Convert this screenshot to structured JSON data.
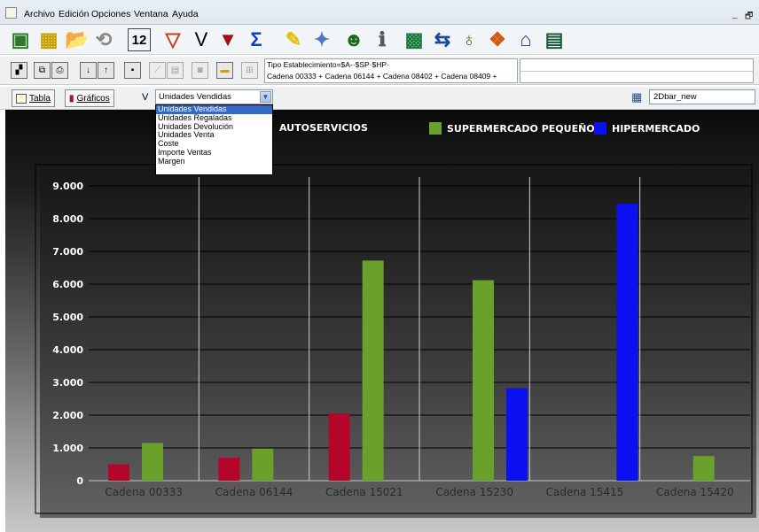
{
  "menu": {
    "items": [
      "Archivo",
      "Edición",
      "Opciones",
      "Ventana",
      "Ayuda"
    ],
    "window_controls": [
      "_",
      "🗗"
    ]
  },
  "toolbar": {
    "icons": [
      "new-report-icon",
      "open-cube-icon",
      "open-folder-icon",
      "refresh-icon",
      "numbering-icon",
      "filter-icon",
      "v-icon",
      "red-filter-icon",
      "sigma-icon",
      "pencil-icon",
      "wand-icon",
      "user-icon",
      "info-icon",
      "export-icon",
      "swap-icon",
      "money-bag-icon",
      "colors-cube-icon",
      "house-icon",
      "calendar-icon"
    ]
  },
  "filter": {
    "line1": "Tipo Establecimiento=$A-·$SP·$HP·",
    "line2": "Cadena 00333 + Cadena 06144 + Cadena 08402 + Cadena 08409 +"
  },
  "view": {
    "tab_table": "Tabla",
    "tab_charts": "Gráficos",
    "measure_label": "V",
    "measure_selected": "Unidades Vendidas",
    "measure_options": [
      "Unidades Vendidas",
      "Unidades Regaladas",
      "Unidades Devolución",
      "Unidades Venta",
      "Coste",
      "Importe Ventas",
      "Margen"
    ],
    "template_name": "2Dbar_new"
  },
  "colors": {
    "autoservicios": "#b5052a",
    "supermercado": "#6aa02c",
    "hipermercado": "#0a10f0"
  },
  "chart_data": {
    "type": "bar",
    "categories": [
      "Cadena 00333",
      "Cadena 06144",
      "Cadena 15021",
      "Cadena 15230",
      "Cadena 15415",
      "Cadena 15420"
    ],
    "series": [
      {
        "name": "AUTOSERVICIOS",
        "values": [
          500,
          700,
          2050,
          0,
          0,
          0
        ]
      },
      {
        "name": "SUPERMERCADO PEQUEÑO",
        "values": [
          1150,
          980,
          6720,
          6120,
          0,
          750
        ]
      },
      {
        "name": "HIPERMERCADO",
        "values": [
          0,
          0,
          0,
          2820,
          8460,
          0
        ]
      }
    ],
    "yticks": [
      "0",
      "1.000",
      "2.000",
      "3.000",
      "4.000",
      "5.000",
      "6.000",
      "7.000",
      "8.000",
      "9.000"
    ],
    "ylim": [
      0,
      9000
    ],
    "grid": true,
    "legend_position": "top"
  }
}
